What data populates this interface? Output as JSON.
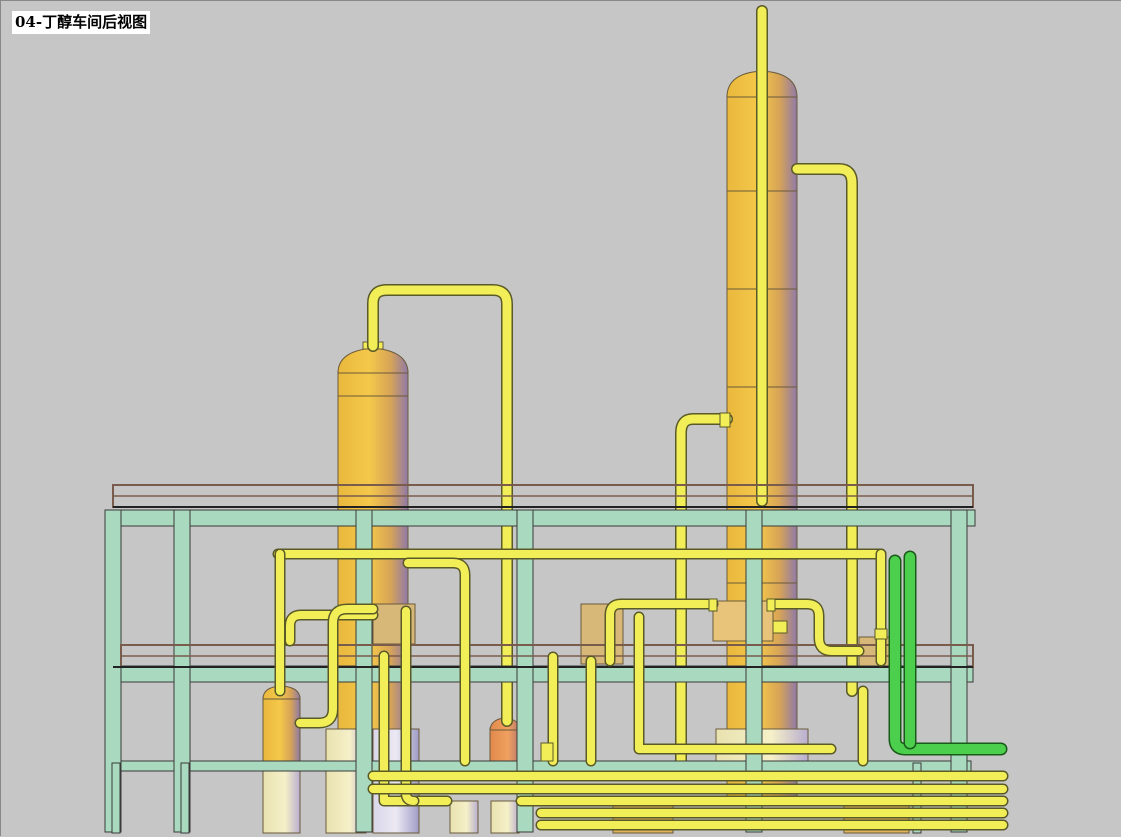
{
  "drawing": {
    "title": "04-丁醇车间后视图"
  },
  "colors": {
    "background": "#c6c6c6",
    "steel_frame": "#a9d9bf",
    "frame_outline": "#3a3a3a",
    "pipe": "#f2ee58",
    "vessel_light": "#f4c84a",
    "vessel_shade": "#8f79a8",
    "railing": "#8a6a5a",
    "green_pipe": "#4ccf4c",
    "copper_vessel": "#e08a4c"
  },
  "icons": [
    "column-vessel",
    "drum-vessel",
    "piping",
    "steel-structure",
    "handrail"
  ]
}
